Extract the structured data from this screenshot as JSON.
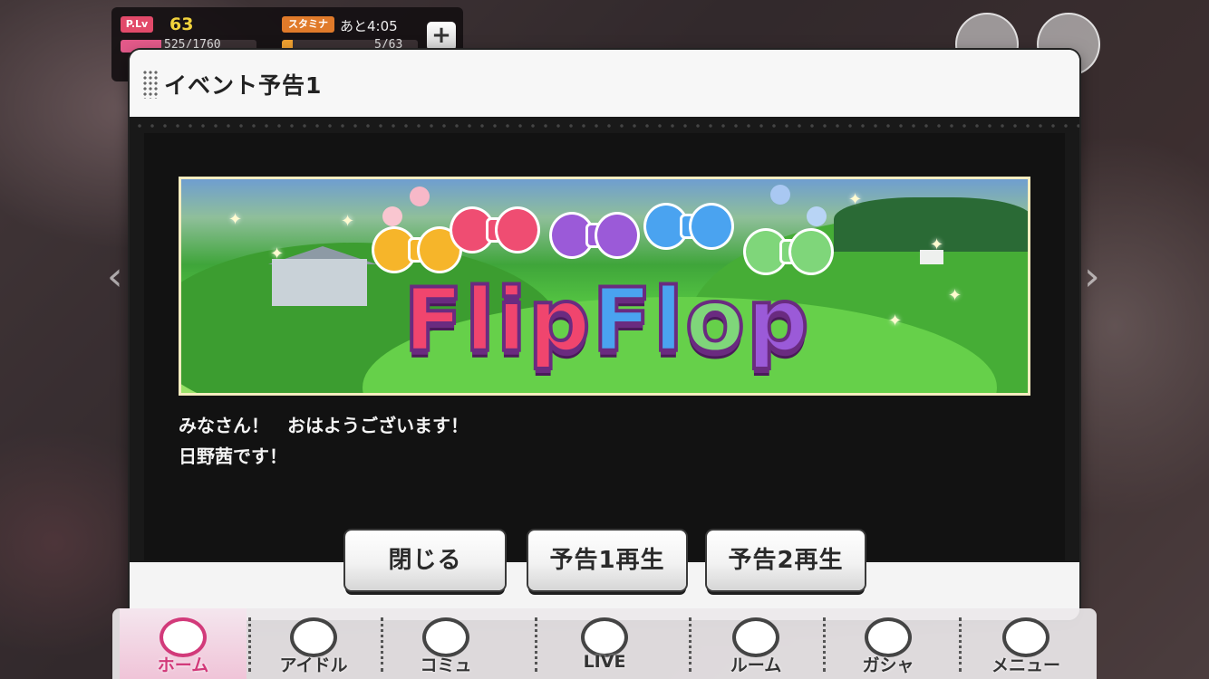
{
  "hud": {
    "plv_label": "P.Lv",
    "plv_value": "63",
    "exp_text": "525/1760",
    "exp_progress": 0.3,
    "stamina_label": "スタミナ",
    "stamina_time": "あと4:05",
    "stamina_text": "5/63",
    "stamina_progress": 0.08,
    "plus_label": "+"
  },
  "dialog": {
    "title": "イベント予告1",
    "banner_logo": "FlipFlop",
    "message": "みなさん！　おはようございます！\n日野茜です！",
    "buttons": {
      "close": "閉じる",
      "play1": "予告1再生",
      "play2": "予告2再生"
    }
  },
  "nav": {
    "items": [
      {
        "label": "ホーム",
        "icon": "home-icon"
      },
      {
        "label": "アイドル",
        "icon": "idol-icon"
      },
      {
        "label": "コミュ",
        "icon": "commu-icon"
      },
      {
        "label": "LIVE",
        "icon": "live-icon"
      },
      {
        "label": "ルーム",
        "icon": "room-icon"
      },
      {
        "label": "ガシャ",
        "icon": "gacha-icon"
      },
      {
        "label": "メニュー",
        "icon": "menu-icon"
      }
    ]
  },
  "colors": {
    "accent_pink": "#d23a7a",
    "plv_yellow": "#f2d33c",
    "stamina_orange": "#e07a2a"
  }
}
